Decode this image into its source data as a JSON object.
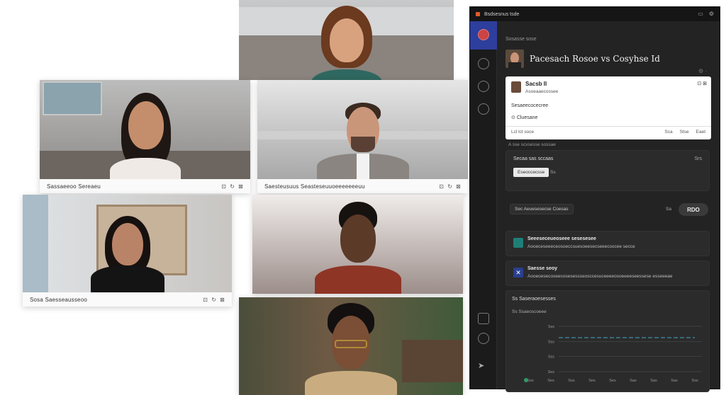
{
  "tiles": [
    {
      "name": "Sassaeeoo Sereaeu",
      "controls": [
        "⊡",
        "↻",
        "⊠",
        "⊡"
      ]
    },
    {
      "name": "Saesteusuus Seasteseuuoeeeeeeeuu",
      "controls": [
        "⊡",
        "↻",
        "⊠",
        "⊡"
      ]
    },
    {
      "name": "Sosa Saesseausseoo",
      "controls": [
        "⊡",
        "↻",
        "⊠",
        "⊡"
      ]
    }
  ],
  "panel": {
    "app_label": "Bsdsesnus tsde",
    "crumb": "Sosasse sose",
    "title": "Pacesach Rosoe vs Cosyhse Id",
    "card": {
      "name": "Sacsb Il",
      "sub": "Asoeaaecossee",
      "line1": "Sesaeecocecree",
      "line2": "Cluesane",
      "footer": "Lcl lct soce",
      "footer_right": [
        "Sca",
        "Stse",
        "Eaet"
      ]
    },
    "between_label": "A sse scxsesse sossae",
    "section1": {
      "title": "Secaa sas sccaas",
      "right": "Srs",
      "chip": "Eseoccecsse",
      "chip_suffix": "Ss"
    },
    "toolbar": {
      "left": "Sec Aeuesesecse Coesas",
      "mid": "Sa",
      "badge": "RDO"
    },
    "notice1": {
      "title": "Seeeseceueoseee sesesesee",
      "text": "Aooeceseeeceosoeccsuesoeesecseeecsocee secce"
    },
    "notice2": {
      "title": "Saesse seoy",
      "text": "Aooeoesecoseecosesessseosccesuceeeeosoeeeeseessese esseeeae"
    },
    "chart_card": {
      "title": "Ss Saseraoesesses",
      "sub": "Ss Ssaeoscoeee"
    },
    "rail_icons": [
      "home-icon",
      "chat-icon",
      "calendar-icon",
      "help-icon",
      "apps-icon",
      "settings-icon",
      "rocket-icon"
    ]
  },
  "chart_data": {
    "type": "line",
    "title": "",
    "xlabel": "",
    "ylabel": "",
    "categories": [
      "Sss",
      "Ses",
      "Sss",
      "Ses",
      "Ses",
      "Sas",
      "Sas",
      "Sas",
      "Sss"
    ],
    "y_ticks": [
      "Sss",
      "Sss",
      "Sss",
      "Ses"
    ],
    "series": [
      {
        "values": [
          1,
          1,
          1,
          1,
          1,
          1,
          1,
          1,
          1
        ]
      }
    ],
    "ylim": [
      0,
      4
    ],
    "grid": true
  },
  "colors": {
    "accent": "#2d3e9c",
    "panel_bg": "#232323",
    "card_bg": "#2b2b2b",
    "line": "#3d8fa8"
  }
}
